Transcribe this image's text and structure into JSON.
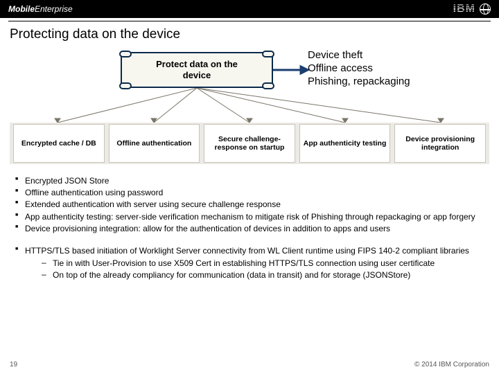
{
  "header": {
    "brand_bold": "Mobile",
    "brand_light": "Enterprise",
    "ibm": "IBM"
  },
  "title": "Protecting data on the device",
  "diagram": {
    "root": "Protect data on the\ndevice",
    "threats": [
      "Device theft",
      "Offline access",
      "Phishing, repackaging"
    ],
    "children": [
      "Encrypted cache / DB",
      "Offline authentication",
      "Secure challenge-response on startup",
      "App authenticity testing",
      "Device provisioning integration"
    ]
  },
  "bullets1": [
    "Encrypted JSON Store",
    "Offline authentication using password",
    "Extended authentication with server using secure challenge response",
    "App authenticity testing: server-side verification mechanism to mitigate risk of Phishing through repackaging or app forgery",
    "Device provisioning integration: allow for the authentication of devices in addition to apps and users"
  ],
  "bullets2": {
    "main": "HTTPS/TLS based initiation of Worklight Server connectivity from WL Client runtime using FIPS 140-2 compliant libraries",
    "subs": [
      "Tie in with User-Provision to use X509 Cert in establishing HTTPS/TLS connection using user certificate",
      "On top of the already compliancy for communication (data in transit) and for storage (JSONStore)"
    ]
  },
  "footer": {
    "page": "19",
    "copyright": "© 2014 IBM Corporation"
  }
}
